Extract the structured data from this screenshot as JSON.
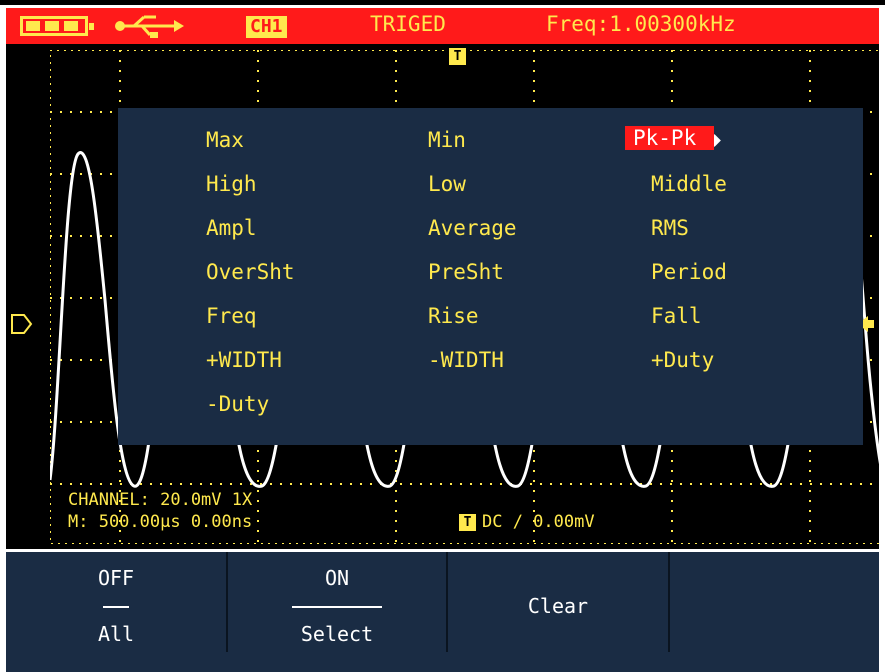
{
  "status": {
    "channel_badge": "CH1",
    "trigger_state": "TRIGED",
    "frequency": "Freq:1.00300kHz"
  },
  "menu": {
    "items": [
      {
        "label": "Max"
      },
      {
        "label": "Min"
      },
      {
        "label": "Pk-Pk",
        "selected": true
      },
      {
        "label": "High"
      },
      {
        "label": "Low"
      },
      {
        "label": "Middle"
      },
      {
        "label": "Ampl"
      },
      {
        "label": "Average"
      },
      {
        "label": "RMS"
      },
      {
        "label": "OverSht"
      },
      {
        "label": "PreSht"
      },
      {
        "label": "Period"
      },
      {
        "label": "Freq"
      },
      {
        "label": "Rise"
      },
      {
        "label": "Fall"
      },
      {
        "label": "+WIDTH"
      },
      {
        "label": "-WIDTH"
      },
      {
        "label": "+Duty"
      },
      {
        "label": "-Duty"
      }
    ]
  },
  "waveform_info": {
    "channel_line": "CHANNEL: 20.0mV  1X",
    "timebase_line": "M: 500.00μs 0.00ns",
    "trigger_icon": "T",
    "trigger_line": "DC ∕ 0.00mV"
  },
  "softkeys": [
    {
      "top": "OFF",
      "bottom": "All"
    },
    {
      "top": "ON",
      "bottom": "Select"
    },
    {
      "label": "Clear"
    }
  ],
  "colors": {
    "status_bar": "#ff1a1a",
    "text_yellow": "#ffe94d",
    "menu_bg": "#1a2c44",
    "screen_bg": "#000000"
  }
}
